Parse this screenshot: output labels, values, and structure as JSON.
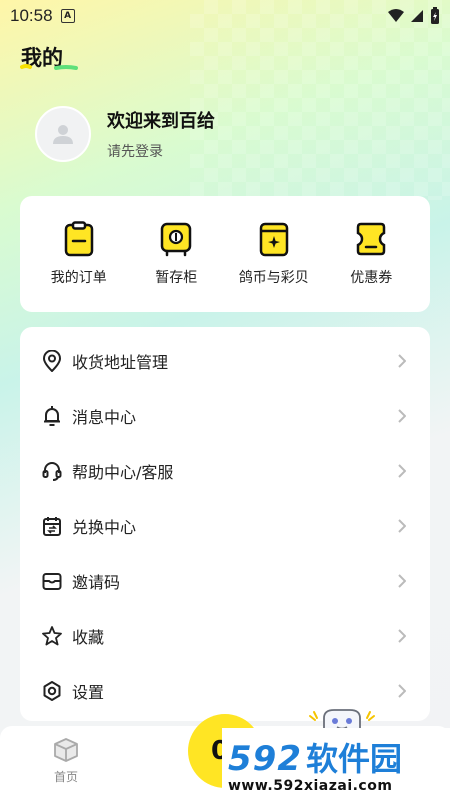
{
  "status_bar": {
    "time": "10:58",
    "badge": "A"
  },
  "page": {
    "title": "我的"
  },
  "profile": {
    "welcome": "欢迎来到百给",
    "login_hint": "请先登录"
  },
  "quick_actions": [
    {
      "label": "我的订单",
      "icon": "clipboard-icon"
    },
    {
      "label": "暂存柜",
      "icon": "locker-icon"
    },
    {
      "label": "鸽币与彩贝",
      "icon": "coin-card-icon"
    },
    {
      "label": "优惠券",
      "icon": "coupon-icon"
    }
  ],
  "menu": [
    {
      "label": "收货地址管理",
      "icon": "location-pin-icon"
    },
    {
      "label": "消息中心",
      "icon": "bell-icon"
    },
    {
      "label": "帮助中心/客服",
      "icon": "headset-icon"
    },
    {
      "label": "兑换中心",
      "icon": "calendar-exchange-icon"
    },
    {
      "label": "邀请码",
      "icon": "envelope-icon"
    },
    {
      "label": "收藏",
      "icon": "star-icon"
    },
    {
      "label": "设置",
      "icon": "gear-icon"
    }
  ],
  "bottom_nav": {
    "home_label": "首页",
    "center_text": "0."
  },
  "watermark": {
    "number": "592",
    "name": "软件园",
    "url": "www.592xiazai.com"
  },
  "colors": {
    "accent_yellow": "#ffe524",
    "accent_green": "#5ee07a",
    "watermark_blue": "#1e7fd8"
  }
}
